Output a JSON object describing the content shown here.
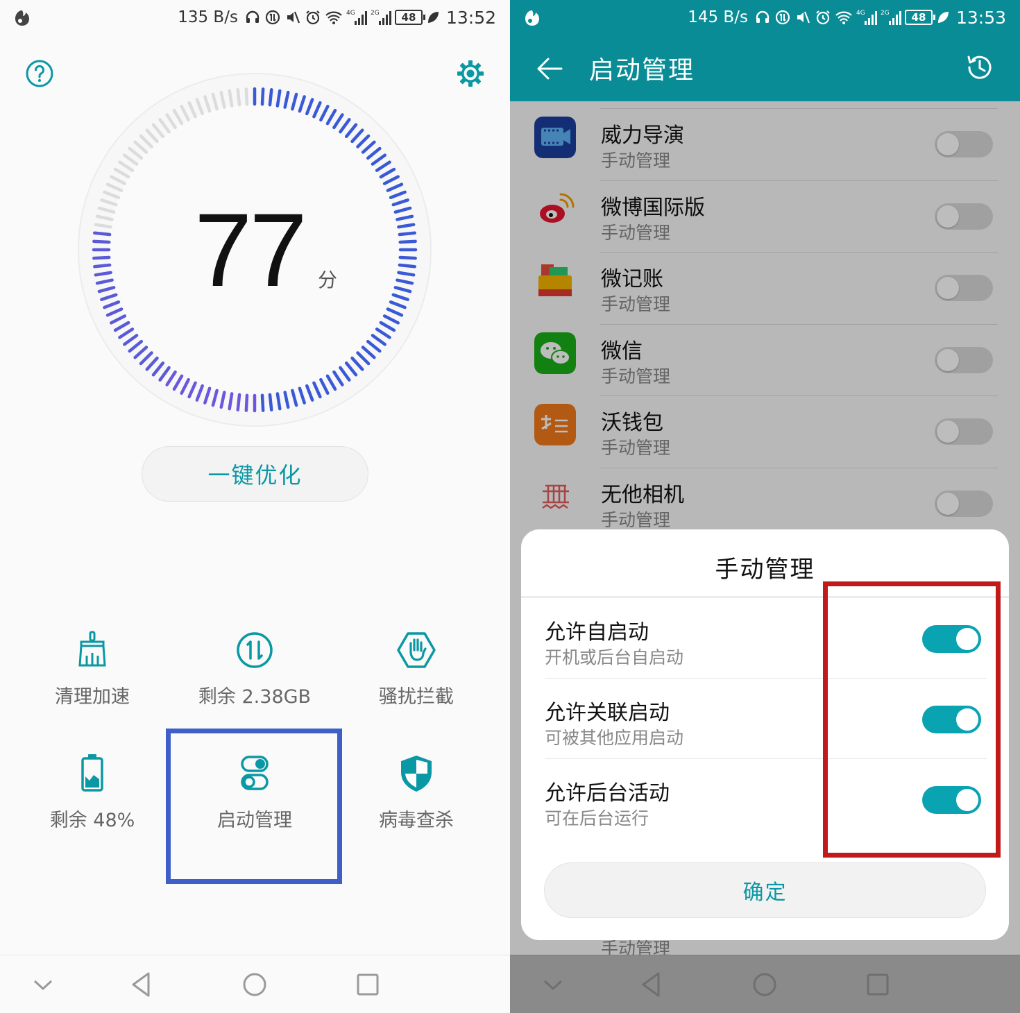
{
  "left": {
    "status": {
      "speed": "135 B/s",
      "net1": "4G",
      "net2": "2G",
      "battery": "48",
      "time": "13:52"
    },
    "score": {
      "value": "77",
      "unit": "分"
    },
    "optimize_label": "一键优化",
    "tiles": [
      {
        "label": "清理加速",
        "icon": "broom-icon"
      },
      {
        "label": "剩余 2.38GB",
        "icon": "memory-icon"
      },
      {
        "label": "骚扰拦截",
        "icon": "hand-block-icon"
      },
      {
        "label": "剩余 48%",
        "icon": "battery-icon"
      },
      {
        "label": "启动管理",
        "icon": "toggle-switches-icon"
      },
      {
        "label": "病毒查杀",
        "icon": "shield-icon"
      }
    ],
    "colors": {
      "accent": "#0a98a4",
      "highlight": "#3d5fc7"
    }
  },
  "right": {
    "status": {
      "speed": "145 B/s",
      "net1": "4G",
      "net2": "2G",
      "battery": "48",
      "time": "13:53"
    },
    "title": "启动管理",
    "apps": [
      {
        "name": "威力导演",
        "mode": "手动管理",
        "icon": "powerdirector-icon"
      },
      {
        "name": "微博国际版",
        "mode": "手动管理",
        "icon": "weibo-icon"
      },
      {
        "name": "微记账",
        "mode": "手动管理",
        "icon": "wallet-icon"
      },
      {
        "name": "微信",
        "mode": "手动管理",
        "icon": "wechat-icon"
      },
      {
        "name": "沃钱包",
        "mode": "手动管理",
        "icon": "wo-wallet-icon"
      },
      {
        "name": "无他相机",
        "mode": "手动管理",
        "icon": "wuta-camera-icon"
      }
    ],
    "peek_mode": "手动管理",
    "dialog": {
      "title": "手动管理",
      "options": [
        {
          "title": "允许自启动",
          "desc": "开机或后台自启动",
          "on": true
        },
        {
          "title": "允许关联启动",
          "desc": "可被其他应用启动",
          "on": true
        },
        {
          "title": "允许后台活动",
          "desc": "可在后台运行",
          "on": true
        }
      ],
      "confirm": "确定"
    },
    "colors": {
      "appbar": "#098c95",
      "switch_on": "#0aa3b2",
      "highlight": "#c01a1a"
    }
  }
}
